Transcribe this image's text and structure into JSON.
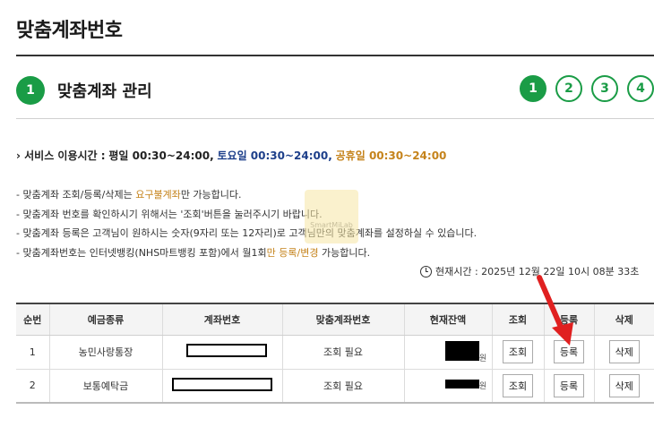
{
  "page_title": "맞춤계좌번호",
  "section": {
    "step": "1",
    "title": "맞춤계좌 관리"
  },
  "steps": [
    "1",
    "2",
    "3",
    "4"
  ],
  "service": {
    "label": "› 서비스 이용시간 :",
    "weekday": "평일 00:30~24:00,",
    "saturday": "토요일 00:30~24:00,",
    "holiday": "공휴일 00:30~24:00"
  },
  "notes": {
    "n1_pre": "- 맞춤계좌 조회/등록/삭제는 ",
    "n1_hl": "요구불계좌",
    "n1_post": "만 가능합니다.",
    "n2": "- 맞춤계좌 번호를 확인하시기 위해서는 '조회'버튼을 눌러주시기 바랍니다.",
    "n3": "- 맞춤계좌 등록은 고객님이 원하시는 숫자(9자리 또는 12자리)로 고객님만의 맞춤계좌를 설정하실 수 있습니다.",
    "n4_pre": "- 맞춤계좌번호는 인터넷뱅킹(NHS마트뱅킹 포함)에서 월1회",
    "n4_hl": "만 등록/변경",
    "n4_post": " 가능합니다."
  },
  "watermark": "SmartMiLab",
  "current_time": "현재시간 : 2025년 12월 22일 10시 08분 33초",
  "table": {
    "headers": [
      "순번",
      "예금종류",
      "계좌번호",
      "맞춤계좌번호",
      "현재잔액",
      "조회",
      "등록",
      "삭제"
    ],
    "rows": [
      {
        "no": "1",
        "type": "농민사랑통장",
        "custom": "조회 필요",
        "won": "원",
        "view": "조회",
        "register": "등록",
        "delete": "삭제"
      },
      {
        "no": "2",
        "type": "보통예탁금",
        "custom": "조회 필요",
        "won": "원",
        "view": "조회",
        "register": "등록",
        "delete": "삭제"
      }
    ]
  },
  "colors": {
    "accent": "#1a9c46",
    "blue": "#1d3f8a",
    "orange": "#c5831b",
    "arrow": "#e02020"
  }
}
